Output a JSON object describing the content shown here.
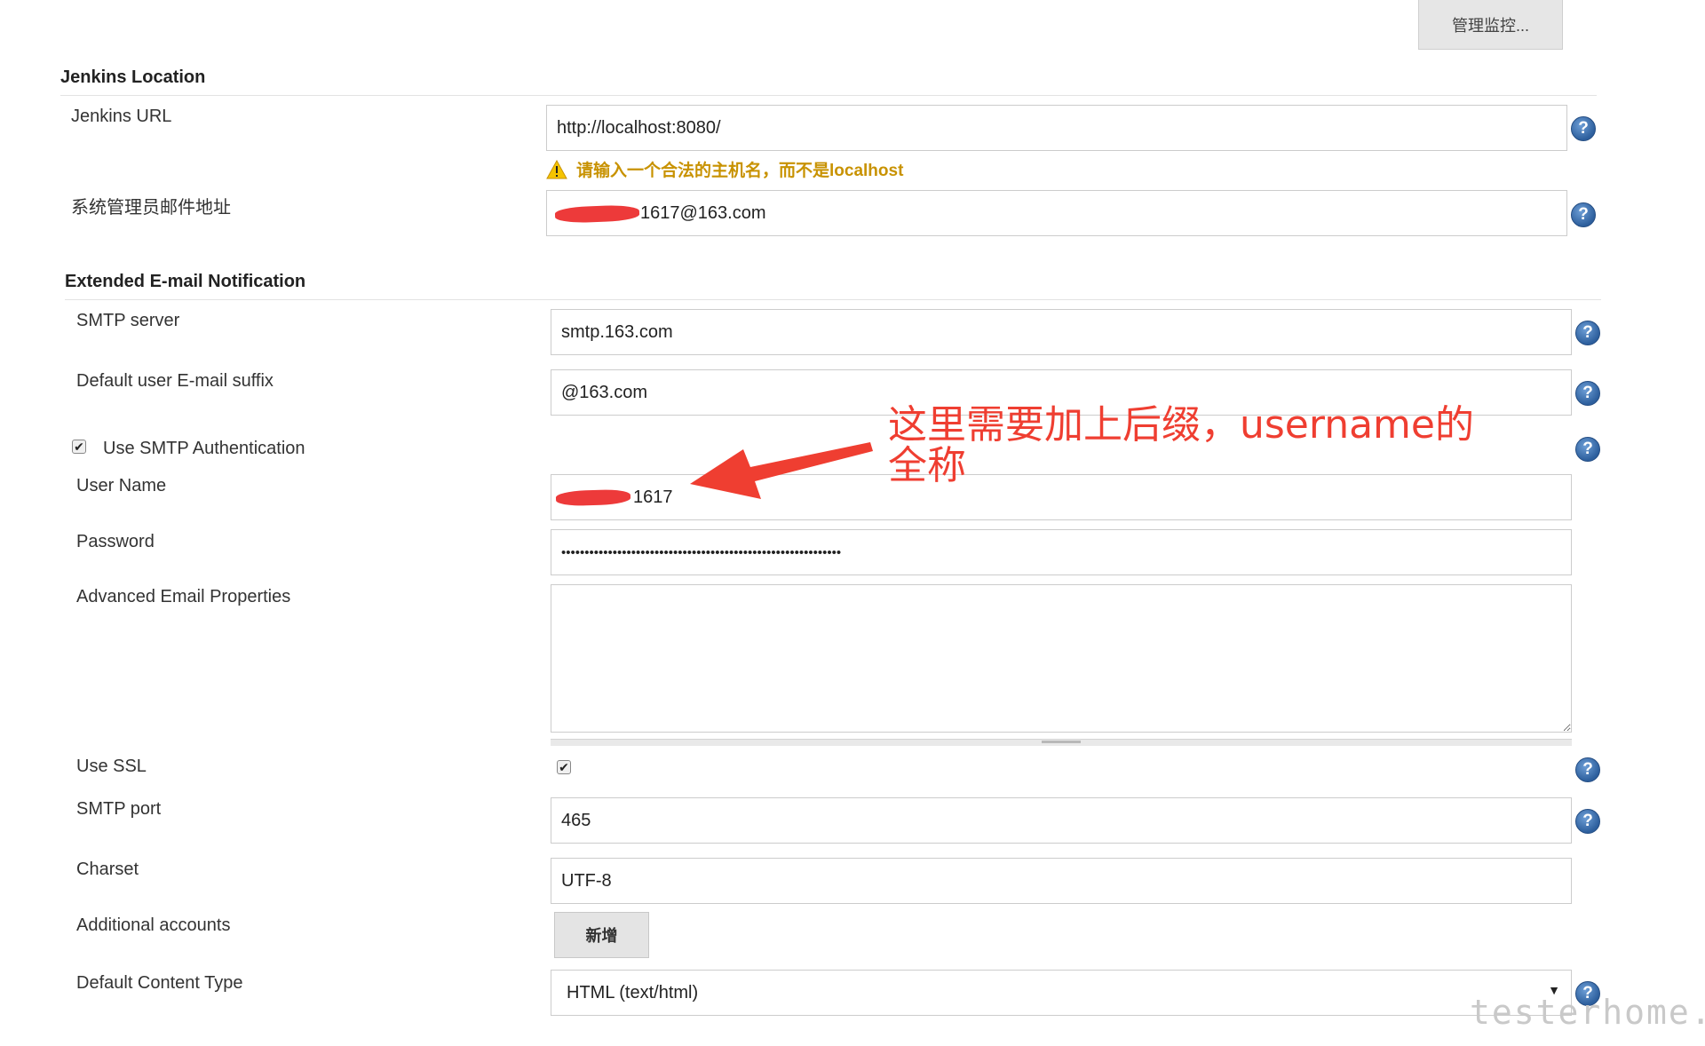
{
  "top_button_label": "管理监控...",
  "jenkins_location": {
    "title": "Jenkins Location",
    "url_label": "Jenkins URL",
    "url_value": "http://localhost:8080/",
    "url_warning": "请输入一个合法的主机名，而不是localhost",
    "admin_email_label": "系统管理员邮件地址",
    "admin_email_value": "1617@163.com"
  },
  "email_notification": {
    "title": "Extended E-mail Notification",
    "smtp_server_label": "SMTP server",
    "smtp_server_value": "smtp.163.com",
    "default_suffix_label": "Default user E-mail suffix",
    "default_suffix_value": "@163.com",
    "use_smtp_auth_label": "Use SMTP Authentication",
    "use_smtp_auth_checked": true,
    "username_label": "User Name",
    "username_value": "1617",
    "password_label": "Password",
    "password_value": "••••••••••••••••••••••••••••••••••••••••••••••••••••••••••••",
    "advanced_props_label": "Advanced Email Properties",
    "advanced_props_value": "",
    "use_ssl_label": "Use SSL",
    "use_ssl_checked": true,
    "smtp_port_label": "SMTP port",
    "smtp_port_value": "465",
    "charset_label": "Charset",
    "charset_value": "UTF-8",
    "additional_accounts_label": "Additional accounts",
    "add_button_label": "新增",
    "content_type_label": "Default Content Type",
    "content_type_value": "HTML (text/html)"
  },
  "annotation_text": "这里需要加上后缀，username的全称",
  "watermark_text": "testerhome.com",
  "colors": {
    "annotation": "#ef3e31",
    "warning": "#c89200",
    "help_icon": "#2d5f9d"
  }
}
